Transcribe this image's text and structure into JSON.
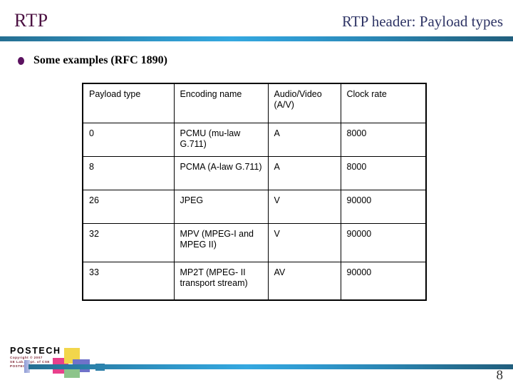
{
  "header": {
    "title_left": "RTP",
    "title_right": "RTP header: Payload types",
    "title_left_color": "#4b1142",
    "title_right_color": "#2e3465",
    "rule_color": "#34a8e0"
  },
  "bullet": {
    "text": "Some examples (RFC 1890)",
    "marker_color": "#5b1260"
  },
  "table": {
    "columns": [
      "Payload type",
      "Encoding name",
      "Audio/Video (A/V)",
      "Clock rate"
    ],
    "header_cells": [
      "Payload type",
      "Encoding name",
      "Audio/Video (A/V)",
      "Clock rate"
    ],
    "rows": [
      {
        "payload_type": "0",
        "encoding_name": "PCMU (mu-law G.711)",
        "av": "A",
        "clock_rate": "8000"
      },
      {
        "payload_type": "8",
        "encoding_name": "PCMA (A-law G.711)",
        "av": "A",
        "clock_rate": "8000"
      },
      {
        "payload_type": "26",
        "encoding_name": "JPEG",
        "av": "V",
        "clock_rate": "90000"
      },
      {
        "payload_type": "32",
        "encoding_name": "MPV (MPEG-I and MPEG II)",
        "av": "V",
        "clock_rate": "90000"
      },
      {
        "payload_type": "33",
        "encoding_name": "MP2T (MPEG- II transport stream)",
        "av": "AV",
        "clock_rate": "90000"
      }
    ]
  },
  "footer": {
    "wordmark": "POSTECH",
    "copyright_lines": [
      "Copyright © 2007",
      "SE Lab. Dept. of CSE",
      "POSTECH, R.O.Korea"
    ],
    "page_number": "8",
    "logo_colors": {
      "yellow": "#f2d64b",
      "magenta": "#e8408c",
      "blue": "#6f72c9",
      "green": "#8cc48a",
      "teal": "#2e7fa8"
    }
  }
}
